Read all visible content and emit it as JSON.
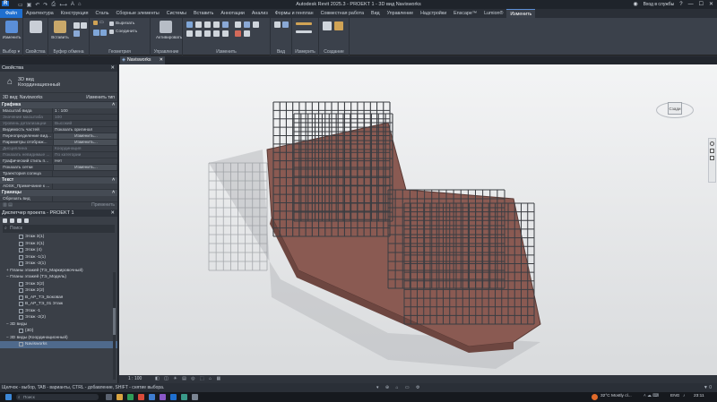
{
  "titlebar": {
    "title": "Autodesk Revit 2025.3 - PROEKT 1 - 3D вид Navisworks",
    "sign_in": "Вход в службы",
    "help": "?"
  },
  "ribbon_tabs": [
    "Файл",
    "Архитектура",
    "Конструкция",
    "Сталь",
    "Сборные элементы",
    "Системы",
    "Вставить",
    "Аннотации",
    "Анализ",
    "Формы и генплан",
    "Совместная работа",
    "Вид",
    "Управление",
    "Надстройки",
    "Enscape™",
    "Lumion®",
    "Изменить"
  ],
  "ribbon": {
    "groups": [
      {
        "label": "Выбор ▾"
      },
      {
        "label": "Свойства"
      },
      {
        "label": "Буфер обмена"
      },
      {
        "label": "Геометрия"
      },
      {
        "label": "Управление"
      },
      {
        "label": "Изменить"
      },
      {
        "label": "Вид"
      },
      {
        "label": "Измерить"
      },
      {
        "label": "Создание"
      }
    ],
    "modify_label": "Изменить",
    "insert_label": "Вставить",
    "cut_label": "Вырезать",
    "join_label": "Соединить",
    "activate_label": "Активировать"
  },
  "document_tab": "Navisworks",
  "properties": {
    "header": "Свойства",
    "type_name": "3D вид",
    "type_sub": "Координационный",
    "selector": "3D вид: Navisworks",
    "edit_type": "Изменить тип",
    "section_graphics": "Графика",
    "rows": [
      {
        "k": "Масштаб вида",
        "v": "1 : 100",
        "dim": false
      },
      {
        "k": "Значение масштаба",
        "v": "100",
        "dim": true
      },
      {
        "k": "Уровень детализации",
        "v": "Высокий",
        "dim": true
      },
      {
        "k": "Видимость частей",
        "v": "Показать оригинал",
        "dim": false
      },
      {
        "k": "Переопределение вид...",
        "v": "Изменить...",
        "dim": false
      },
      {
        "k": "Параметры отображ...",
        "v": "Изменить...",
        "dim": false
      },
      {
        "k": "Дисциплина",
        "v": "Координация",
        "dim": true
      },
      {
        "k": "Показать невидимые ...",
        "v": "По категории",
        "dim": true
      },
      {
        "k": "Графический стиль п...",
        "v": "Нет",
        "dim": false
      },
      {
        "k": "Показать сетки",
        "v": "Изменить...",
        "dim": false
      },
      {
        "k": "Траектория солнца",
        "v": "",
        "dim": false
      }
    ],
    "section_text": "Текст",
    "text_row": "ADSK_Примечание к ...",
    "section_bounds": "Границы",
    "bounds_row": "Обрезать вид",
    "apply": "Применить"
  },
  "browser": {
    "header": "Диспетчер проекта - PROEKT 1",
    "search_placeholder": "Поиск",
    "nodes": [
      {
        "t": "Этаж 3(1)",
        "lvl": 3,
        "box": true
      },
      {
        "t": "Этаж 2(1)",
        "lvl": 3,
        "box": true
      },
      {
        "t": "Этаж (4)",
        "lvl": 3,
        "box": true
      },
      {
        "t": "Этаж -1(1)",
        "lvl": 3,
        "box": true
      },
      {
        "t": "Этаж -2(1)",
        "lvl": 3,
        "box": true
      },
      {
        "t": "+  Планы этажей (ТЭ_Маркировочный)",
        "lvl": 1,
        "box": false
      },
      {
        "t": "−  Планы этажей (ТЭ_Модель)",
        "lvl": 1,
        "box": false
      },
      {
        "t": "Этаж 3(2)",
        "lvl": 3,
        "box": true
      },
      {
        "t": "Этаж 2(2)",
        "lvl": 3,
        "box": true
      },
      {
        "t": "В_АР_ТЭ_Боковая",
        "lvl": 3,
        "box": true
      },
      {
        "t": "В_АР_ТЭ_01 Этаж",
        "lvl": 3,
        "box": true
      },
      {
        "t": "Этаж -1",
        "lvl": 3,
        "box": true
      },
      {
        "t": "Этаж -2(2)",
        "lvl": 3,
        "box": true
      },
      {
        "t": "−  3D виды",
        "lvl": 1,
        "box": false
      },
      {
        "t": "{3D}",
        "lvl": 3,
        "box": true
      },
      {
        "t": "−  3D виды (Координационный)",
        "lvl": 1,
        "box": false
      },
      {
        "t": "Navisworks",
        "lvl": 3,
        "box": true
      }
    ]
  },
  "viewcube": {
    "face": "Сзади"
  },
  "view_status": {
    "scale": "1 : 100"
  },
  "statusbar": {
    "text": "Щелчок - выбор, TAB - варианты, CTRL - добавление, SHIFT - снятие выбора."
  },
  "taskbar": {
    "search_placeholder": "Поиск",
    "weather": "32°C  Mostly cl...",
    "lang": "ENG",
    "time": "23:11"
  },
  "colors": {
    "accent": "#1f6fcf",
    "rebar": "#3a3d42",
    "concrete": "#8a5a52"
  }
}
